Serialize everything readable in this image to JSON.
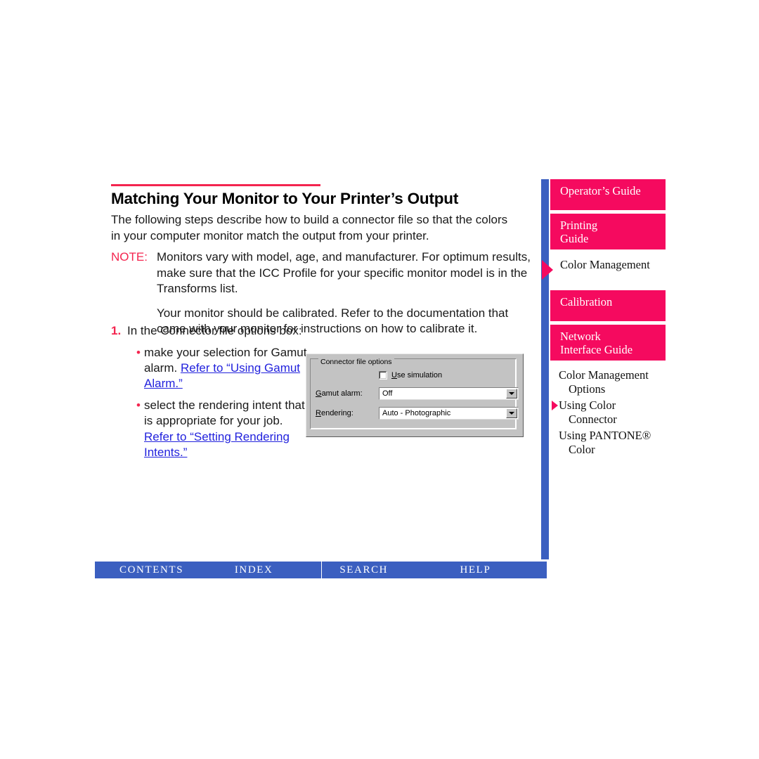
{
  "document": {
    "title": "Matching Your Monitor to Your Printer’s Output",
    "intro": "The following steps describe how to build a connector file so that the colors in your computer monitor match the output from your printer.",
    "note": {
      "label": "NOTE:",
      "paragraph1": "Monitors vary with model, age, and manufacturer. For optimum results, make sure that the ICC Profile for your specific monitor model is in the Transforms list.",
      "paragraph2": "Your monitor should be calibrated. Refer to the documentation that came with your monitor for instructions on how to calibrate it."
    },
    "step": {
      "number": "1.",
      "text": "In the Connector file options box:",
      "bullets": [
        {
          "marker": "•",
          "text_before": "make your selection for Gamut alarm. ",
          "link": "Refer to “Using Gamut Alarm.”"
        },
        {
          "marker": "•",
          "text_before": "select the rendering intent that is appropriate for your job. ",
          "link": "Refer to “Setting Rendering Intents.”"
        }
      ]
    }
  },
  "dialog": {
    "group_title": "Connector file options",
    "checkbox": {
      "accelerator": "U",
      "label_rest": "se simulation",
      "checked": false
    },
    "fields": [
      {
        "accelerator": "G",
        "label_rest": "amut alarm:",
        "value": "Off"
      },
      {
        "accelerator": "R",
        "label_rest": "endering:",
        "value": "Auto - Photographic"
      }
    ]
  },
  "sidebar": {
    "panels": [
      {
        "label": "Operator’s Guide",
        "active": false,
        "marker": false
      },
      {
        "label": "Printing\nGuide",
        "active": false,
        "marker": false
      },
      {
        "label": "Color Management",
        "active": true,
        "marker": true
      },
      {
        "label": "Calibration",
        "active": false,
        "marker": false
      },
      {
        "label": "Network\nInterface Guide",
        "active": false,
        "marker": false
      }
    ],
    "subitems": [
      {
        "line1": "Color Management",
        "line2": "Options",
        "marker": false
      },
      {
        "line1": "Using Color",
        "line2": "Connector",
        "marker": true
      },
      {
        "line1": "Using PANTONE®",
        "line2": "Color",
        "marker": false
      }
    ]
  },
  "bottom_nav": {
    "items": [
      {
        "label": "CONTENTS"
      },
      {
        "label": "INDEX"
      },
      {
        "label": "SEARCH"
      },
      {
        "label": "HELP"
      }
    ]
  },
  "colors": {
    "accent_pink": "#F50A5F",
    "rule_red": "#F4254F",
    "nav_blue": "#3B5FC0",
    "link_blue": "#2222DD",
    "dialog_gray": "#C3C3C3"
  }
}
